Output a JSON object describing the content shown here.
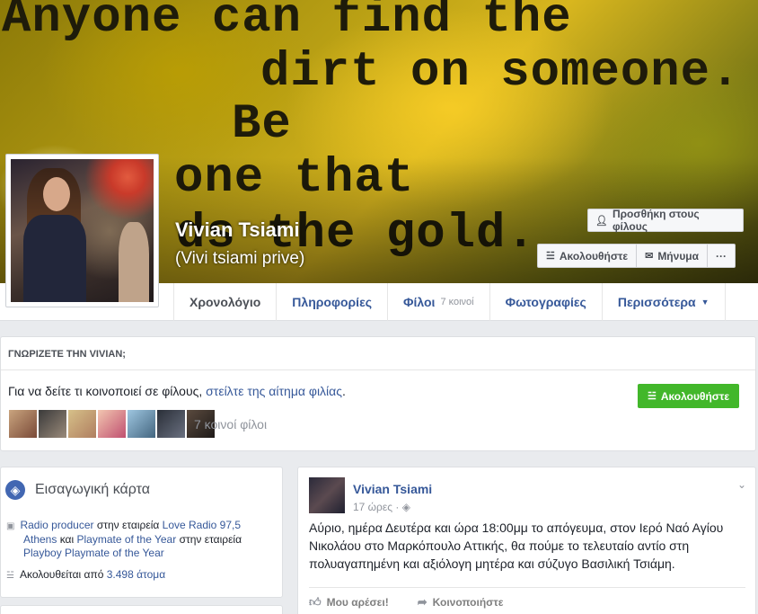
{
  "cover": {
    "quote_lines": [
      "Anyone can find the",
      "dirt on someone.",
      "Be",
      "one that",
      "ds the gold."
    ]
  },
  "profile": {
    "name": "Vivian Tsiami",
    "alternate_name": "(Vivi tsiami prive)"
  },
  "cover_buttons": {
    "add_friend": "Προσθήκη στους φίλους",
    "follow": "Ακολουθήστε",
    "message": "Μήνυμα",
    "more": "···"
  },
  "nav": {
    "tabs": [
      {
        "label": "Χρονολόγιο"
      },
      {
        "label": "Πληροφορίες"
      },
      {
        "label": "Φίλοι",
        "count": "7 κοινοί"
      },
      {
        "label": "Φωτογραφίες"
      },
      {
        "label": "Περισσότερα"
      }
    ]
  },
  "know_card": {
    "heading": "ΓΝΩΡΙΖΕΤΕ ΤΗΝ VIVIAN;",
    "text_prefix": "Για να δείτε τι κοινοποιεί σε φίλους, ",
    "link": "στείλτε της αίτημα φιλίας",
    "text_suffix": ".",
    "follow_button": "Ακολουθήστε",
    "mutual_friends": "7 κοινοί φίλοι"
  },
  "intro": {
    "title": "Εισαγωγική κάρτα",
    "work_title": "Radio producer",
    "at_company": " στην εταιρεία ",
    "company1": "Love Radio 97,5",
    "company1_city": "Athens",
    "and": " και ",
    "title2": "Playmate of the Year",
    "at_company2": " στην εταιρεία",
    "company2": "Playboy Playmate of the Year",
    "followed_by": "Ακολουθείται από ",
    "followers": "3.498 άτομα"
  },
  "post": {
    "author": "Vivian Tsiami",
    "time": "17 ώρες · ",
    "body": "Αύριο, ημέρα Δευτέρα και ώρα 18:00μμ το απόγευμα, στον Ιερό Ναό Αγίου Νικολάου στο Μαρκόπουλο Αττικής, θα πούμε το τελευταίο αντίο στη πολυαγαπημένη και αξιόλογη μητέρα και σύζυγο Βασιλική Τσιάμη.",
    "like": "Μου αρέσει!",
    "share": "Κοινοποιήστε"
  },
  "colors": {
    "link_blue": "#365899",
    "follow_green": "#42b72a",
    "page_bg": "#e9ebee"
  }
}
